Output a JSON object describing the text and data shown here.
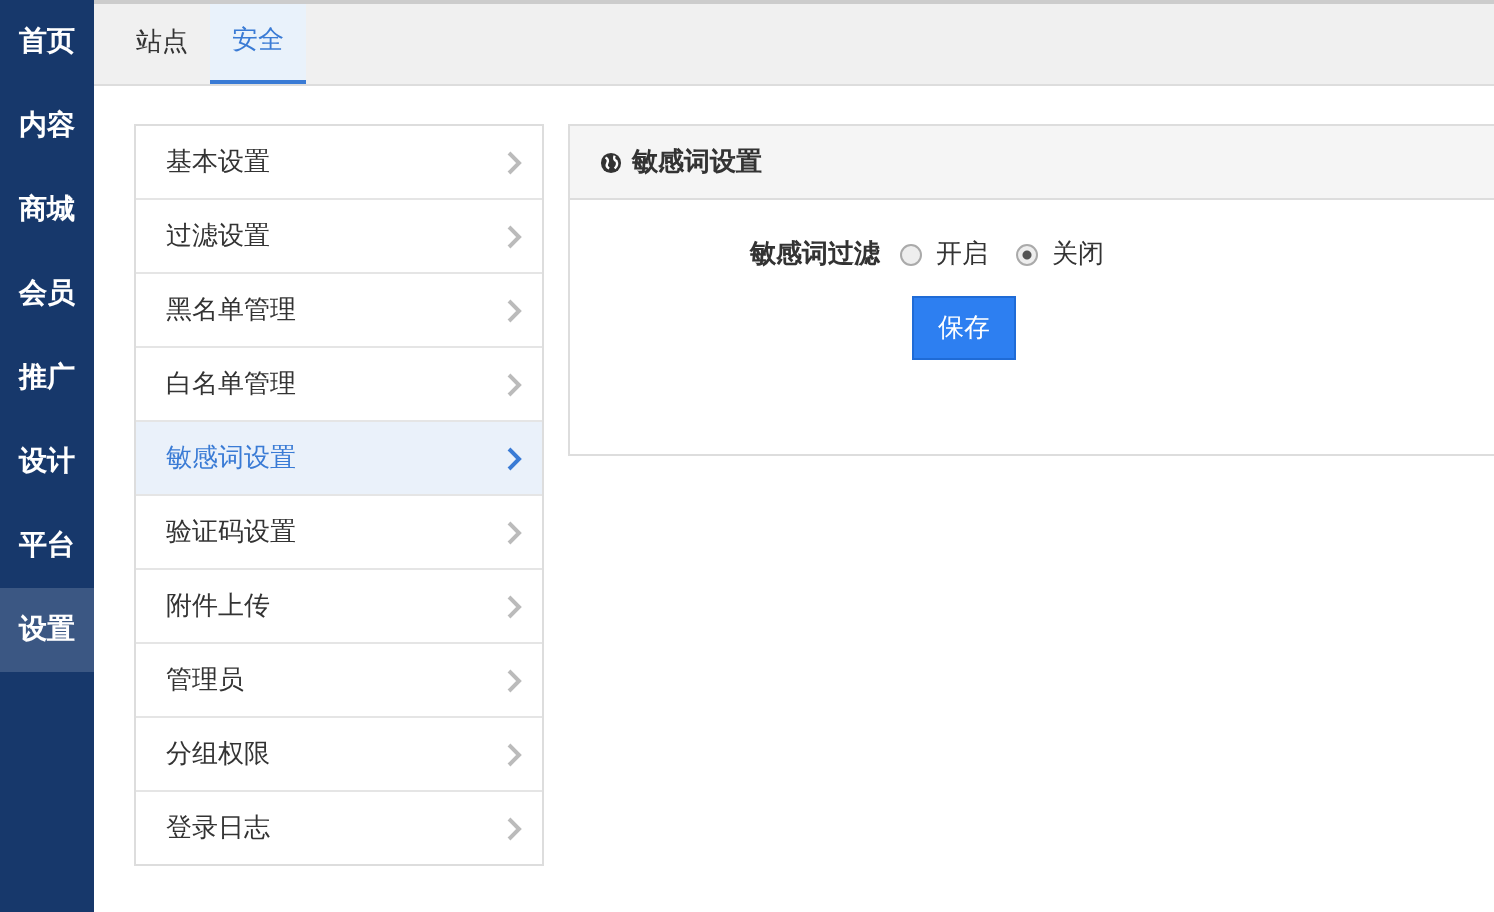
{
  "sidebar": {
    "items": [
      {
        "label": "首页",
        "selected": false
      },
      {
        "label": "内容",
        "selected": false
      },
      {
        "label": "商城",
        "selected": false
      },
      {
        "label": "会员",
        "selected": false
      },
      {
        "label": "推广",
        "selected": false
      },
      {
        "label": "设计",
        "selected": false
      },
      {
        "label": "平台",
        "selected": false
      },
      {
        "label": "设置",
        "selected": true
      }
    ]
  },
  "tabs": [
    {
      "label": "站点",
      "selected": false
    },
    {
      "label": "安全",
      "selected": true
    }
  ],
  "menu": {
    "items": [
      {
        "label": "基本设置",
        "selected": false
      },
      {
        "label": "过滤设置",
        "selected": false
      },
      {
        "label": "黑名单管理",
        "selected": false
      },
      {
        "label": "白名单管理",
        "selected": false
      },
      {
        "label": "敏感词设置",
        "selected": true
      },
      {
        "label": "验证码设置",
        "selected": false
      },
      {
        "label": "附件上传",
        "selected": false
      },
      {
        "label": "管理员",
        "selected": false
      },
      {
        "label": "分组权限",
        "selected": false
      },
      {
        "label": "登录日志",
        "selected": false
      }
    ]
  },
  "panel": {
    "title": "敏感词设置",
    "field": {
      "label": "敏感词过滤",
      "options": [
        {
          "label": "开启",
          "selected": false
        },
        {
          "label": "关闭",
          "selected": true
        }
      ]
    },
    "save_button": "保存"
  }
}
